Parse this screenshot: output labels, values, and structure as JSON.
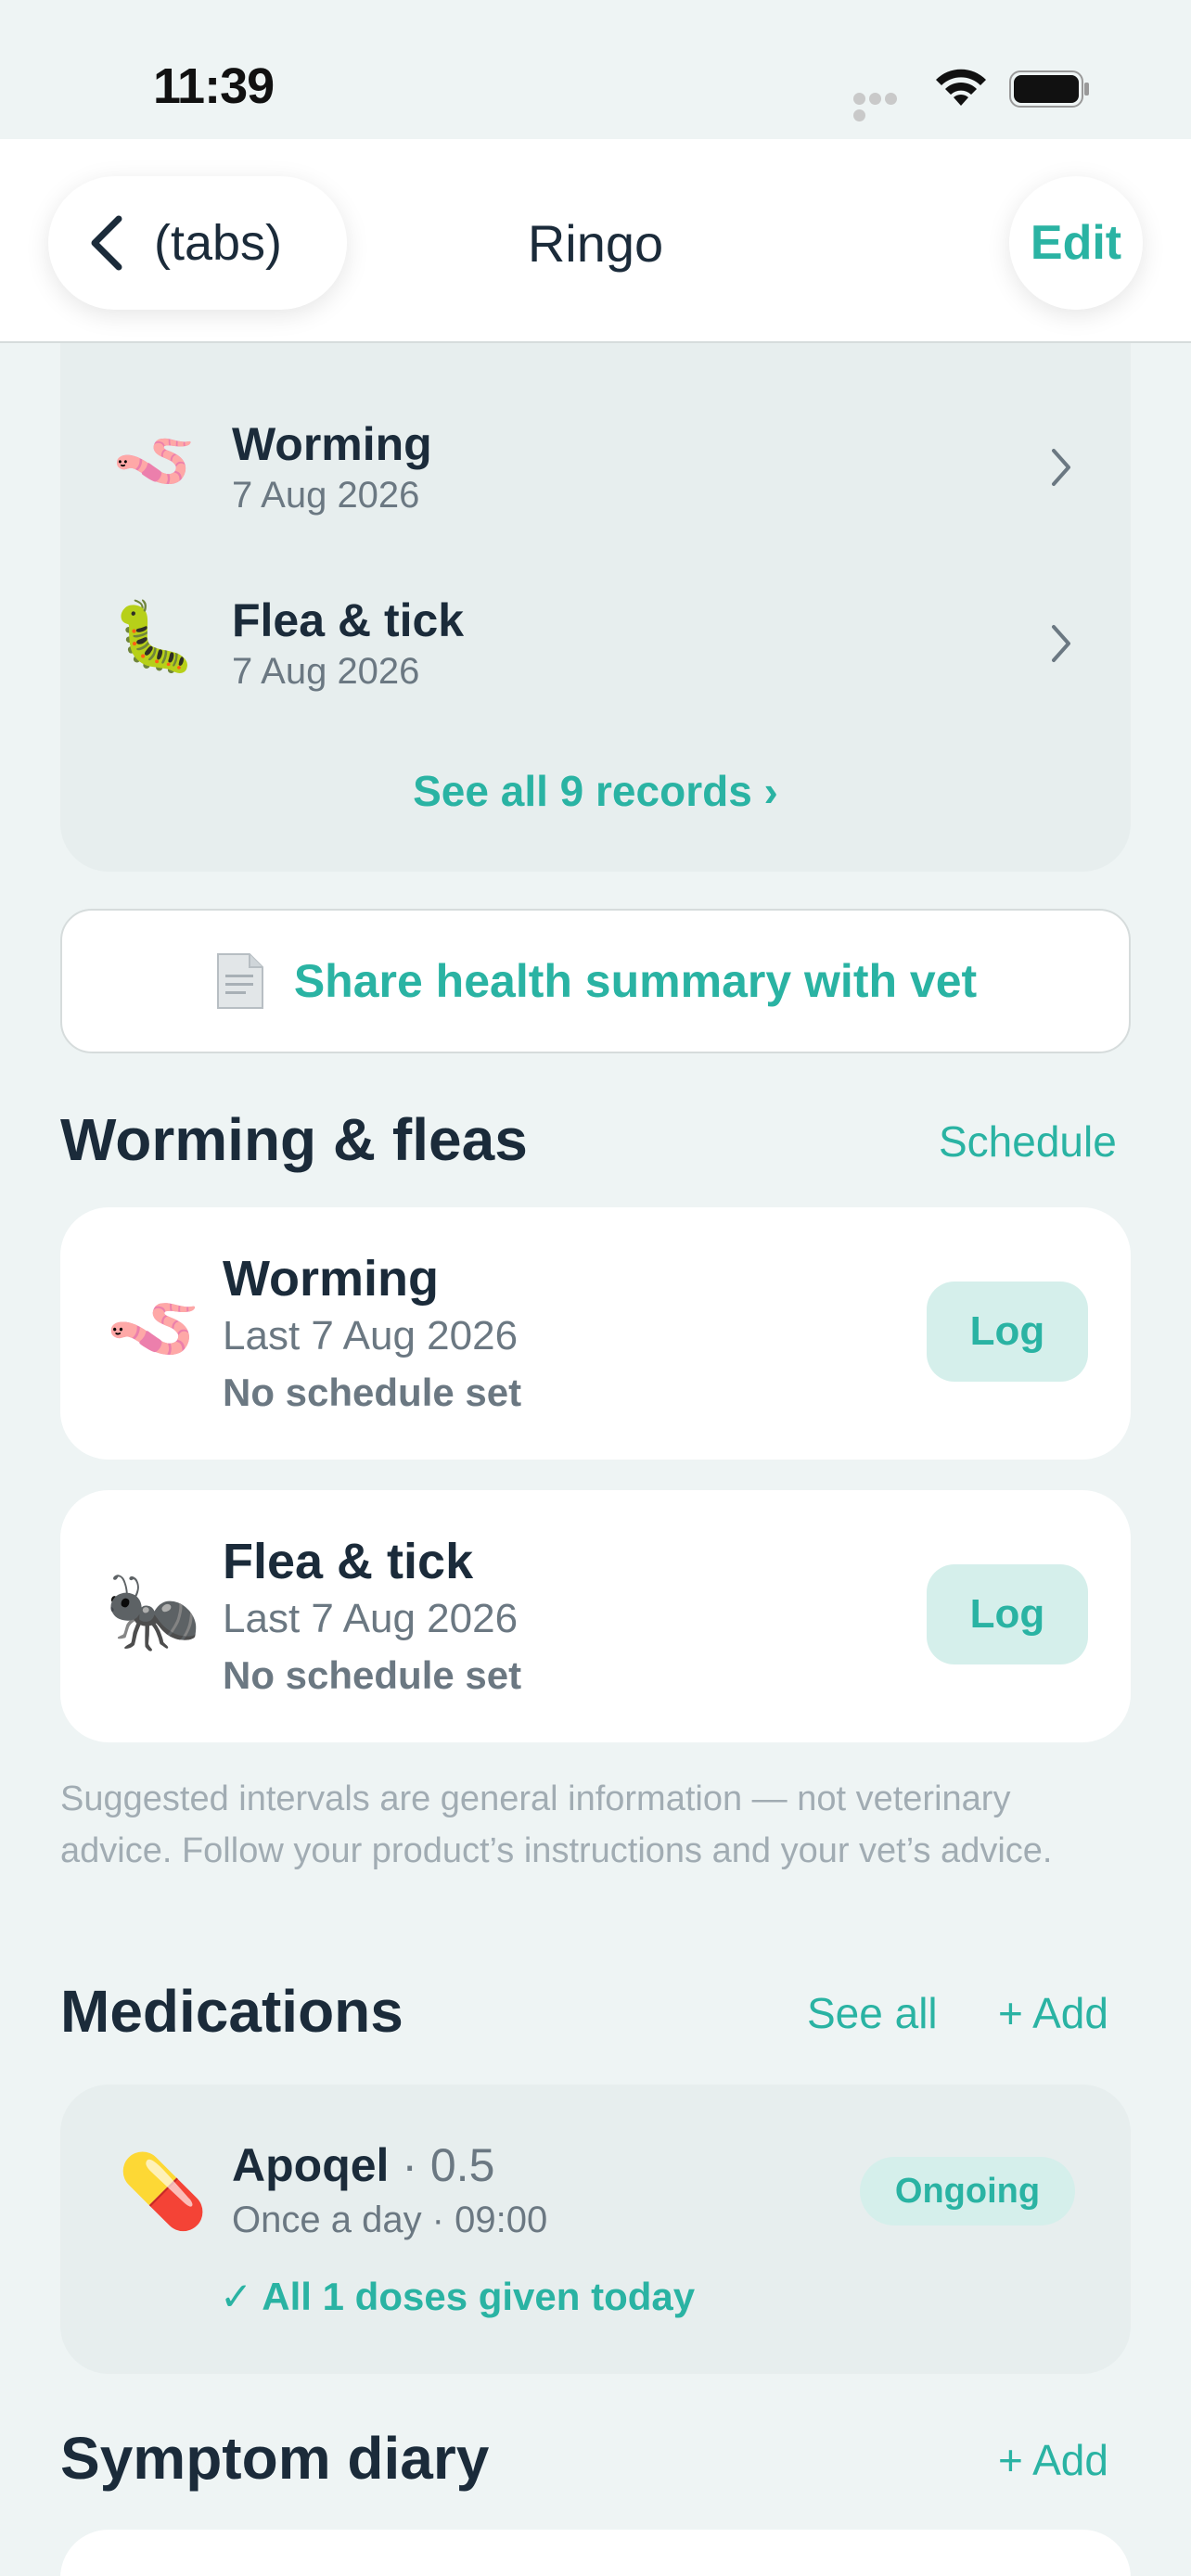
{
  "status_bar": {
    "time": "11:39"
  },
  "nav": {
    "back_label": "(tabs)",
    "title": "Ringo",
    "edit_label": "Edit"
  },
  "records": {
    "items": [
      {
        "icon": "🪱",
        "title": "Worming",
        "date": "7 Aug 2026"
      },
      {
        "icon": "🐛",
        "title": "Flea & tick",
        "date": "7 Aug 2026"
      }
    ],
    "see_all": "See all 9 records ›"
  },
  "share": {
    "label": "Share health summary with vet"
  },
  "worming_section": {
    "title": "Worming & fleas",
    "link": "Schedule",
    "cards": [
      {
        "icon": "🪱",
        "title": "Worming",
        "last": "Last 7 Aug 2026",
        "schedule": "No schedule set",
        "action": "Log"
      },
      {
        "icon": "🐜",
        "title": "Flea & tick",
        "last": "Last 7 Aug 2026",
        "schedule": "No schedule set",
        "action": "Log"
      }
    ],
    "disclaimer": "Suggested intervals are general information — not veterinary advice. Follow your product’s instructions and your vet’s advice."
  },
  "medications": {
    "title": "Medications",
    "see_all": "See all",
    "add": "+ Add",
    "item": {
      "icon": "💊",
      "name": "Apoqel",
      "dose": " · 0.5",
      "frequency": "Once a day · 09:00",
      "status": "Ongoing",
      "given": "✓ All 1 doses given today"
    }
  },
  "symptoms": {
    "title": "Symptom diary",
    "add": "+ Add"
  },
  "colors": {
    "accent": "#2ab3a3",
    "text": "#1b2b3a",
    "muted": "#6b7882",
    "background": "#eef4f4"
  }
}
